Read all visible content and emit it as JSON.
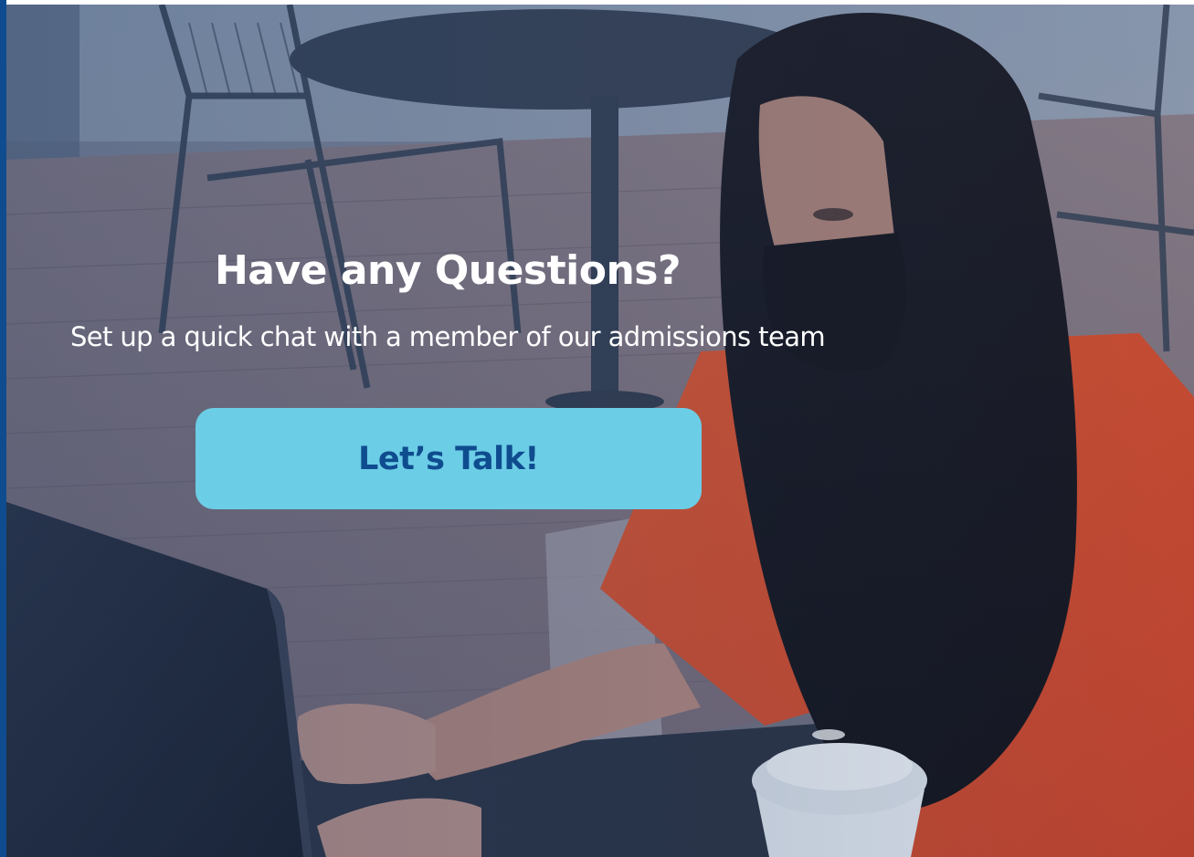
{
  "banner": {
    "heading": "Have any Questions?",
    "subtitle": "Set up a quick chat with a member of our admissions team",
    "cta_label": "Let’s Talk!"
  },
  "colors": {
    "accent_blue": "#0f4c8f",
    "button_fill": "#6ccde6",
    "text_on_photo": "#ffffff"
  }
}
